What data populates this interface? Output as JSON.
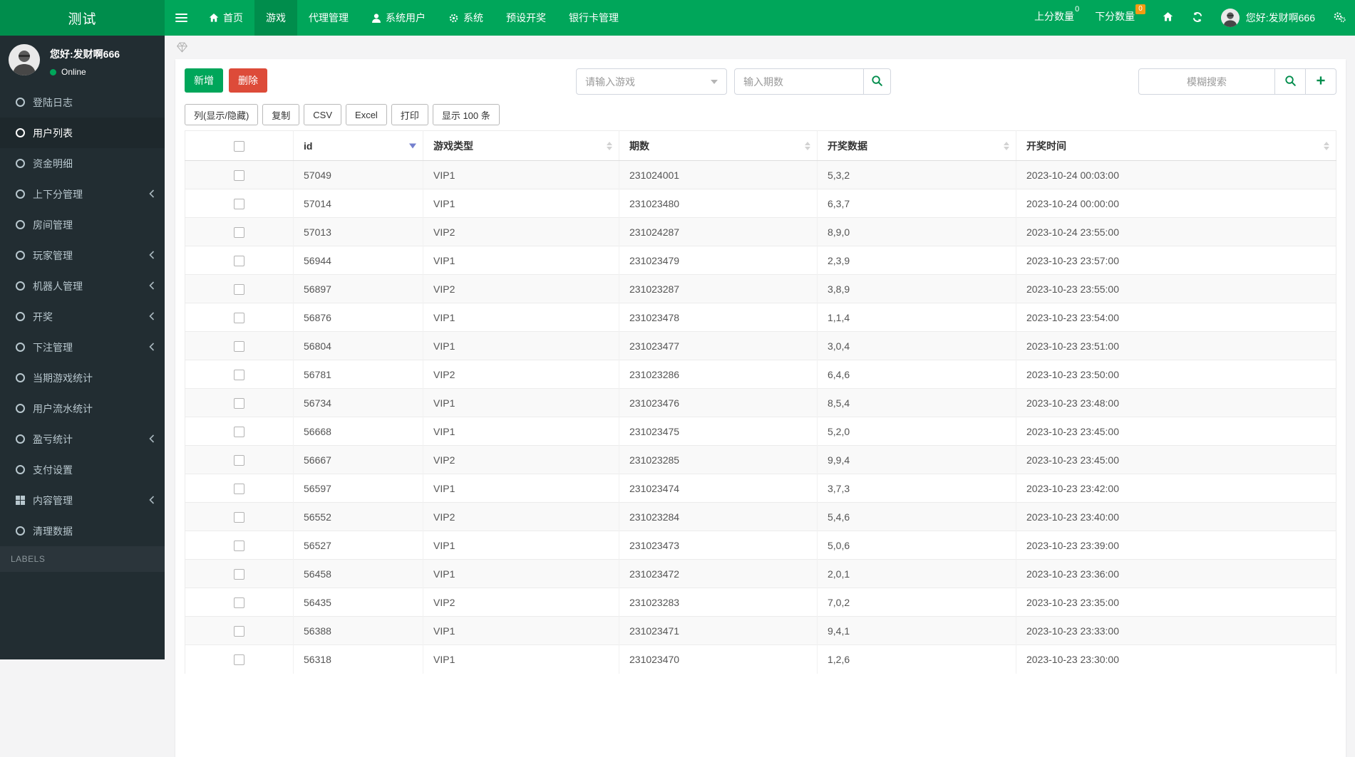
{
  "navbar": {
    "brand": "测试",
    "menu": [
      {
        "key": "home",
        "label": "首页",
        "icon": "home",
        "active": false
      },
      {
        "key": "games",
        "label": "游戏",
        "icon": null,
        "active": true
      },
      {
        "key": "agents",
        "label": "代理管理",
        "icon": null,
        "active": false
      },
      {
        "key": "system-users",
        "label": "系统用户",
        "icon": "user",
        "active": false
      },
      {
        "key": "system",
        "label": "系统",
        "icon": "gear",
        "active": false
      },
      {
        "key": "preset-draw",
        "label": "预设开奖",
        "icon": null,
        "active": false
      },
      {
        "key": "bank-cards",
        "label": "银行卡管理",
        "icon": null,
        "active": false
      }
    ],
    "right": {
      "up_label": "上分数量",
      "up_badge": "0",
      "down_label": "下分数量",
      "down_badge": "0",
      "greeting": "您好:发财啊666"
    }
  },
  "sidebar": {
    "user": {
      "greeting": "您好:发财啊666",
      "status": "Online"
    },
    "items": [
      {
        "key": "login-logs",
        "label": "登陆日志",
        "icon": "circle",
        "active": false,
        "arrow": false
      },
      {
        "key": "user-list",
        "label": "用户列表",
        "icon": "circle",
        "active": true,
        "arrow": false
      },
      {
        "key": "funds-detail",
        "label": "资金明细",
        "icon": "circle",
        "active": false,
        "arrow": false
      },
      {
        "key": "score-management",
        "label": "上下分管理",
        "icon": "circle",
        "active": false,
        "arrow": true
      },
      {
        "key": "room-management",
        "label": "房间管理",
        "icon": "circle",
        "active": false,
        "arrow": false
      },
      {
        "key": "player-management",
        "label": "玩家管理",
        "icon": "circle",
        "active": false,
        "arrow": true
      },
      {
        "key": "robot-management",
        "label": "机器人管理",
        "icon": "circle",
        "active": false,
        "arrow": true
      },
      {
        "key": "draw",
        "label": "开奖",
        "icon": "circle",
        "active": false,
        "arrow": true
      },
      {
        "key": "bet-management",
        "label": "下注管理",
        "icon": "circle",
        "active": false,
        "arrow": true
      },
      {
        "key": "current-game-stats",
        "label": "当期游戏统计",
        "icon": "circle",
        "active": false,
        "arrow": false
      },
      {
        "key": "user-flow-stats",
        "label": "用户流水统计",
        "icon": "circle",
        "active": false,
        "arrow": false
      },
      {
        "key": "profit-loss-stats",
        "label": "盈亏统计",
        "icon": "circle",
        "active": false,
        "arrow": true
      },
      {
        "key": "payment-settings",
        "label": "支付设置",
        "icon": "circle",
        "active": false,
        "arrow": false
      },
      {
        "key": "content-management",
        "label": "内容管理",
        "icon": "grid",
        "active": false,
        "arrow": true
      },
      {
        "key": "clean-data",
        "label": "清理数据",
        "icon": "circle",
        "active": false,
        "arrow": false
      }
    ],
    "section_label": "LABELS"
  },
  "toolbar": {
    "add_label": "新增",
    "delete_label": "删除",
    "game_select_placeholder": "请输入游戏",
    "issue_placeholder": "输入期数",
    "fuzzy_placeholder": "模糊搜索",
    "table_buttons": [
      {
        "key": "colvis",
        "label": "列(显示/隐藏)"
      },
      {
        "key": "copy",
        "label": "复制"
      },
      {
        "key": "csv",
        "label": "CSV"
      },
      {
        "key": "excel",
        "label": "Excel"
      },
      {
        "key": "print",
        "label": "打印"
      },
      {
        "key": "page-length",
        "label": "显示 100 条"
      }
    ]
  },
  "table": {
    "columns": [
      {
        "key": "id",
        "label": "id",
        "sort": "desc"
      },
      {
        "key": "game-type",
        "label": "游戏类型",
        "sort": "both"
      },
      {
        "key": "issue",
        "label": "期数",
        "sort": "both"
      },
      {
        "key": "draw-data",
        "label": "开奖数据",
        "sort": "both"
      },
      {
        "key": "draw-time",
        "label": "开奖时间",
        "sort": "both"
      }
    ],
    "rows": [
      [
        "57049",
        "VIP1",
        "231024001",
        "5,3,2",
        "2023-10-24 00:03:00"
      ],
      [
        "57014",
        "VIP1",
        "231023480",
        "6,3,7",
        "2023-10-24 00:00:00"
      ],
      [
        "57013",
        "VIP2",
        "231024287",
        "8,9,0",
        "2023-10-24 23:55:00"
      ],
      [
        "56944",
        "VIP1",
        "231023479",
        "2,3,9",
        "2023-10-23 23:57:00"
      ],
      [
        "56897",
        "VIP2",
        "231023287",
        "3,8,9",
        "2023-10-23 23:55:00"
      ],
      [
        "56876",
        "VIP1",
        "231023478",
        "1,1,4",
        "2023-10-23 23:54:00"
      ],
      [
        "56804",
        "VIP1",
        "231023477",
        "3,0,4",
        "2023-10-23 23:51:00"
      ],
      [
        "56781",
        "VIP2",
        "231023286",
        "6,4,6",
        "2023-10-23 23:50:00"
      ],
      [
        "56734",
        "VIP1",
        "231023476",
        "8,5,4",
        "2023-10-23 23:48:00"
      ],
      [
        "56668",
        "VIP1",
        "231023475",
        "5,2,0",
        "2023-10-23 23:45:00"
      ],
      [
        "56667",
        "VIP2",
        "231023285",
        "9,9,4",
        "2023-10-23 23:45:00"
      ],
      [
        "56597",
        "VIP1",
        "231023474",
        "3,7,3",
        "2023-10-23 23:42:00"
      ],
      [
        "56552",
        "VIP2",
        "231023284",
        "5,4,6",
        "2023-10-23 23:40:00"
      ],
      [
        "56527",
        "VIP1",
        "231023473",
        "5,0,6",
        "2023-10-23 23:39:00"
      ],
      [
        "56458",
        "VIP1",
        "231023472",
        "2,0,1",
        "2023-10-23 23:36:00"
      ],
      [
        "56435",
        "VIP2",
        "231023283",
        "7,0,2",
        "2023-10-23 23:35:00"
      ],
      [
        "56388",
        "VIP1",
        "231023471",
        "9,4,1",
        "2023-10-23 23:33:00"
      ],
      [
        "56318",
        "VIP1",
        "231023470",
        "1,2,6",
        "2023-10-23 23:30:00"
      ]
    ]
  },
  "colors": {
    "primary_green": "#00a65a",
    "dark_green": "#008d4c",
    "danger_red": "#dd4b39",
    "badge_orange": "#f39c12",
    "sidebar_bg": "#222d32",
    "sidebar_active_bg": "#1e282c",
    "sidebar_text": "#b8c7ce",
    "sort_active": "#7480ce"
  }
}
